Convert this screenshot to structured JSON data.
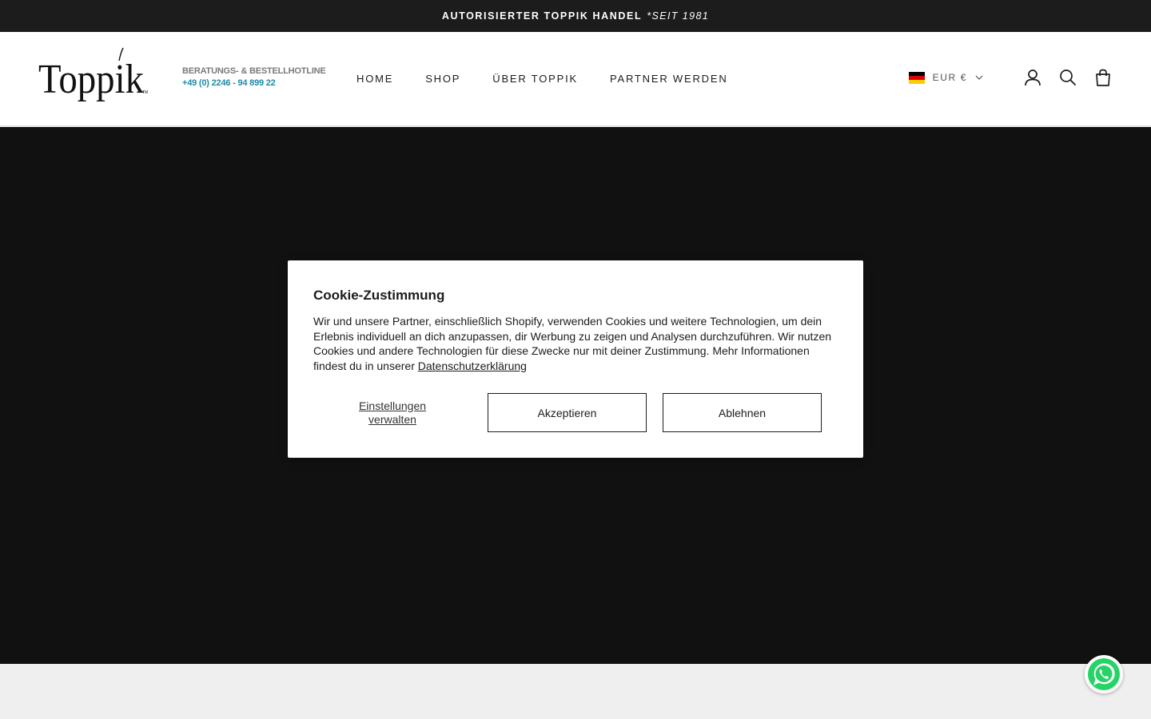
{
  "announcement": {
    "main": "AUTORISIERTER TOPPIK HANDEL",
    "since": "*SEIT 1981"
  },
  "header": {
    "logo_text": "Toppik",
    "hotline_title": "BERATUNGS- & BESTELLHOTLINE",
    "hotline_phone": "+49 (0) 2246 - 94 899 22",
    "nav": [
      "HOME",
      "SHOP",
      "ÜBER TOPPIK",
      "PARTNER WERDEN"
    ],
    "currency": "EUR €",
    "icons": [
      "account-icon",
      "search-icon",
      "cart-icon"
    ]
  },
  "cookie": {
    "title": "Cookie-Zustimmung",
    "body": "Wir und unsere Partner, einschließlich Shopify, verwenden Cookies und weitere Technologien, um dein Erlebnis individuell an dich anzupassen, dir Werbung zu zeigen und Analysen durchzuführen. Wir nutzen Cookies und andere Technologien für diese Zwecke nur mit deiner Zustimmung. Mehr Informationen findest du in unserer ",
    "privacy_link": "Datenschutzerklärung",
    "manage_line1": "Einstellungen",
    "manage_line2": "verwalten",
    "accept": "Akzeptieren",
    "decline": "Ablehnen"
  },
  "colors": {
    "announcement_bg": "#1c1c1c",
    "hero_bg": "#111111",
    "hotline_phone": "#1d8aa8",
    "whatsapp": "#25d366"
  }
}
